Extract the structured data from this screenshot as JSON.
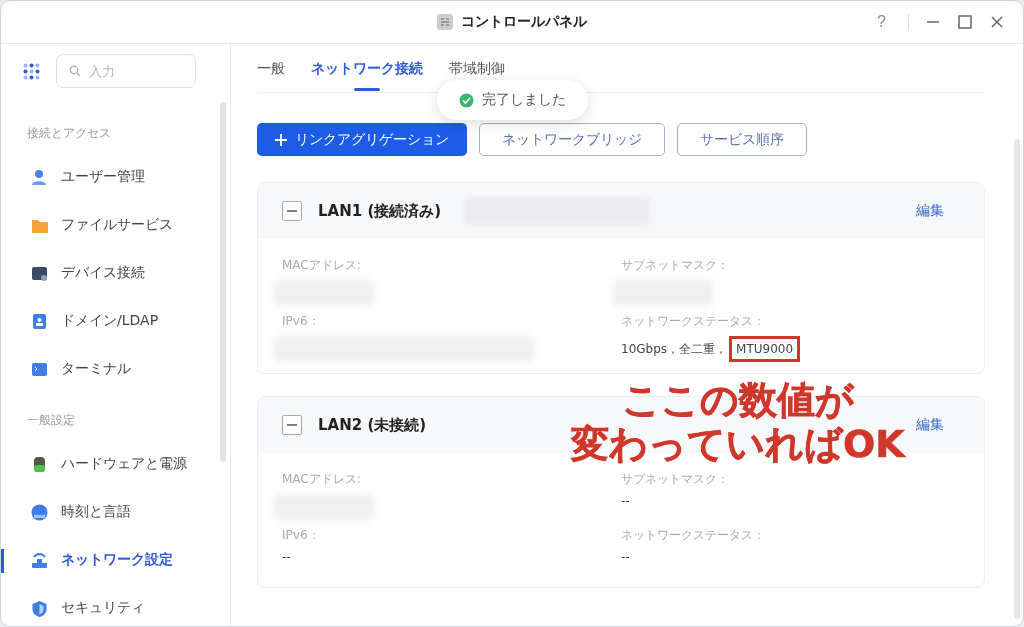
{
  "window": {
    "title": "コントロールパネル",
    "help": "?"
  },
  "sidebar": {
    "search": {
      "placeholder": "入力"
    },
    "sections": [
      {
        "title": "接続とアクセス",
        "items": [
          {
            "label": "ユーザー管理",
            "selected": false
          },
          {
            "label": "ファイルサービス",
            "selected": false
          },
          {
            "label": "デバイス接続",
            "selected": false
          },
          {
            "label": "ドメイン/LDAP",
            "selected": false
          },
          {
            "label": "ターミナル",
            "selected": false
          }
        ]
      },
      {
        "title": "一般設定",
        "items": [
          {
            "label": "ハードウェアと電源",
            "selected": false
          },
          {
            "label": "時刻と言語",
            "selected": false
          },
          {
            "label": "ネットワーク設定",
            "selected": true
          },
          {
            "label": "セキュリティ",
            "selected": false
          }
        ]
      }
    ]
  },
  "tabs": [
    {
      "label": "一般",
      "selected": false
    },
    {
      "label": "ネットワーク接続",
      "selected": true
    },
    {
      "label": "帯域制御",
      "selected": false
    }
  ],
  "toast": {
    "text": "完了しました"
  },
  "buttons": [
    {
      "label": "リンクアグリゲーション",
      "kind": "primary"
    },
    {
      "label": "ネットワークブリッジ",
      "kind": "outline"
    },
    {
      "label": "サービス順序",
      "kind": "outline"
    }
  ],
  "cards": [
    {
      "title": "LAN1 (接続済み)",
      "expanded": true,
      "header_blurred": true,
      "action": "編集",
      "fields": [
        {
          "label": "MACアドレス:",
          "kind": "blurred"
        },
        {
          "label": "サブネットマスク：",
          "kind": "blurred"
        },
        {
          "label": "IPv6：",
          "kind": "blurred_wide"
        },
        {
          "label": "ネットワークステータス：",
          "kind": "text",
          "value": "10Gbps，全二重，",
          "extra": "MTU9000",
          "highlighted": true
        }
      ]
    },
    {
      "title": "LAN2 (未接続)",
      "expanded": true,
      "header_blurred": false,
      "action": "編集",
      "fields": [
        {
          "label": "MACアドレス:",
          "kind": "blurred"
        },
        {
          "label": "サブネットマスク：",
          "kind": "text",
          "value": "--"
        },
        {
          "label": "IPv6：",
          "kind": "text",
          "value": "--"
        },
        {
          "label": "ネットワークステータス：",
          "kind": "text",
          "value": "--"
        }
      ]
    }
  ],
  "annotation": {
    "lines": [
      "ここの数値が",
      "変わっていればOK"
    ]
  }
}
